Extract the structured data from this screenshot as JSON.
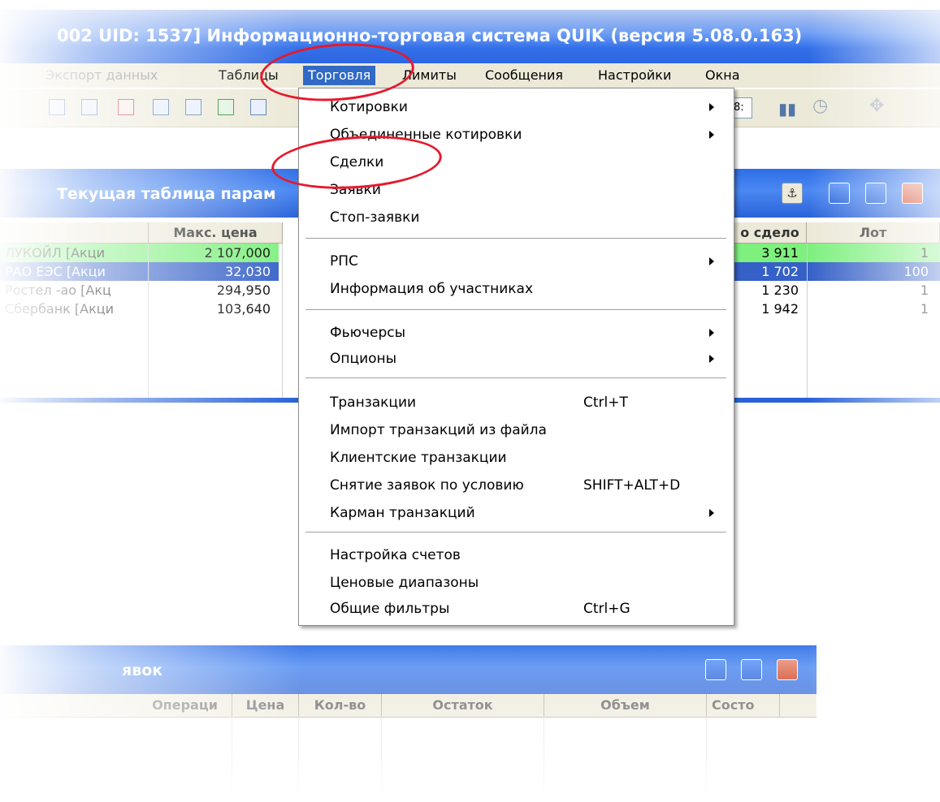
{
  "app": {
    "title": "002  UID: 1537] Информационно-торговая система QUIK (версия 5.08.0.163)"
  },
  "menubar": {
    "export": "Экспорт данных",
    "tables": "Таблицы",
    "trading": "Торговля",
    "limits": "Лимиты",
    "messages": "Сообщения",
    "settings": "Настройки",
    "windows": "Окна"
  },
  "toolbar": {
    "time_field": "8:"
  },
  "param_window": {
    "title": "Текущая таблица парам",
    "columns": {
      "max_price": "Макс. цена",
      "deal": "о сдело",
      "lot": "Лот"
    },
    "rows": [
      {
        "name": "ЛУКОЙЛ [Акци",
        "max_price": "2 107,000",
        "deal": "3 911",
        "lot": "1"
      },
      {
        "name": "РАО ЕЭС [Акци",
        "max_price": "32,030",
        "deal": "1 702",
        "lot": "100"
      },
      {
        "name": "Ростел -ао [Акц",
        "max_price": "294,950",
        "deal": "1 230",
        "lot": "1"
      },
      {
        "name": "Сбербанк [Акци",
        "max_price": "103,640",
        "deal": "1 942",
        "lot": "1"
      }
    ]
  },
  "orders_window": {
    "title": "явок",
    "columns": {
      "operation": "Операци",
      "price": "Цена",
      "qty": "Кол-во",
      "rest": "Остаток",
      "volume": "Объем",
      "state": "Состо"
    }
  },
  "trading_menu": {
    "items": [
      {
        "label": "Котировки",
        "submenu": true
      },
      {
        "label": "Объединенные котировки",
        "submenu": true
      },
      {
        "label": "Сделки"
      },
      {
        "label": "Заявки"
      },
      {
        "label": "Стоп-заявки"
      },
      {
        "label": "РПС",
        "submenu": true
      },
      {
        "label": "Информация об участниках"
      },
      {
        "label": "Фьючерсы",
        "submenu": true
      },
      {
        "label": "Опционы",
        "submenu": true
      },
      {
        "label": "Транзакции",
        "shortcut": "Ctrl+T"
      },
      {
        "label": "Импорт транзакций из файла"
      },
      {
        "label": "Клиентские транзакции"
      },
      {
        "label": "Снятие заявок по условию",
        "shortcut": "SHIFT+ALT+D"
      },
      {
        "label": "Карман транзакций",
        "submenu": true
      },
      {
        "label": "Настройка счетов"
      },
      {
        "label": "Ценовые диапазоны"
      },
      {
        "label": "Общие фильтры",
        "shortcut": "Ctrl+G"
      }
    ]
  },
  "colors": {
    "highlight_ring": "#e8182c",
    "menu_selected": "#316ac5",
    "row_green": "#7ef07e",
    "row_blue": "#3560c8"
  }
}
